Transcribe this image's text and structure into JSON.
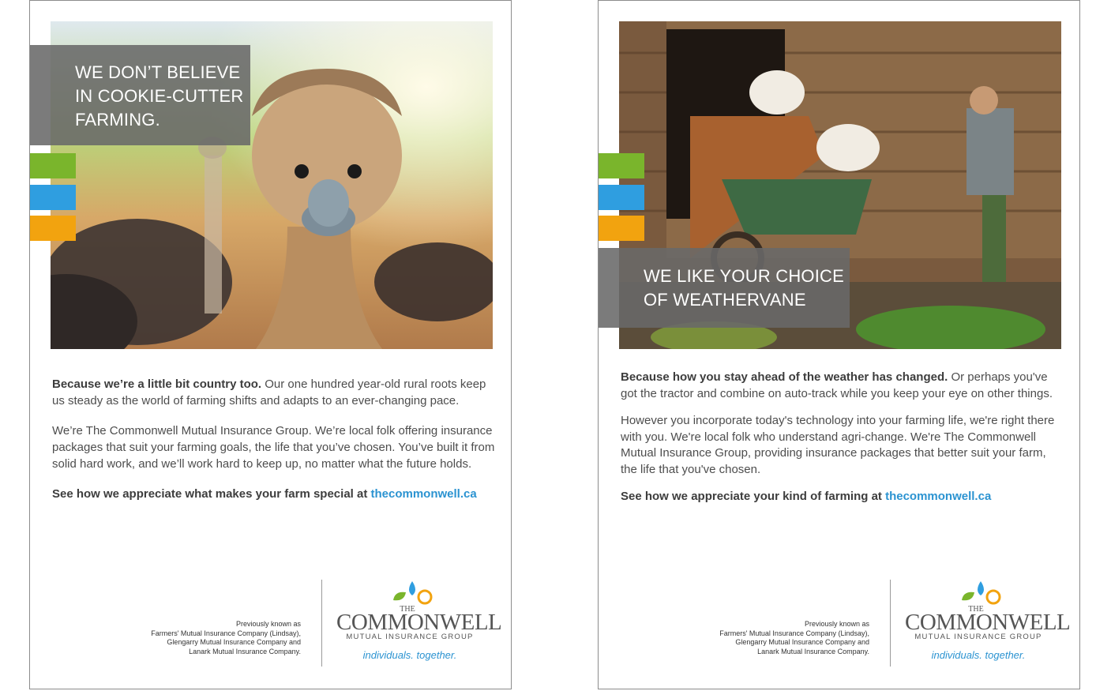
{
  "colors": {
    "green": "#7ab52c",
    "blue": "#2f9ee0",
    "orange": "#f2a30f",
    "link": "#2b93d1"
  },
  "ads": [
    {
      "headline": [
        "WE DON’T BELIEVE",
        "IN COOKIE-CUTTER",
        "FARMING."
      ],
      "image": "ostrich-photo",
      "p1_bold": "Because we’re a little bit country too.",
      "p1_rest": " Our one hundred year-old rural roots keep us steady as the world of farming shifts and adapts to an ever-changing pace.",
      "p2": "We’re The Commonwell Mutual Insurance Group. We’re local folk offering insurance packages that suit your farming goals, the life that you’ve chosen. You’ve built it from solid hard work, and we’ll work hard to keep up, no matter what the future holds.",
      "cta": "See how we appreciate what makes your farm special at ",
      "link": "thecommonwell.ca"
    },
    {
      "headline": [
        "WE LIKE YOUR CHOICE",
        "OF WEATHERVANE"
      ],
      "image": "farmer-cows-photo",
      "p1_bold": "Because how you stay ahead of the weather has changed.",
      "p1_rest": " Or perhaps you've got the tractor and combine on auto-track while you keep your eye on other things.",
      "p2": "However you incorporate today's technology into your farming life, we're right there with you. We're local folk who understand agri-change. We're The Commonwell Mutual Insurance Group, providing insurance packages that better suit your farm, the life that you've chosen.",
      "cta": "See how we appreciate your kind of farming at ",
      "link": "thecommonwell.ca"
    }
  ],
  "previously": [
    "Previously known as",
    "Farmers' Mutual Insurance Company (Lindsay),",
    "Glengarry Mutual Insurance Company and",
    "Lanark Mutual Insurance Company."
  ],
  "logo": {
    "the": "THE",
    "name": "COMMONWELL",
    "sub": "MUTUAL INSURANCE GROUP",
    "tagline": "individuals. together."
  }
}
